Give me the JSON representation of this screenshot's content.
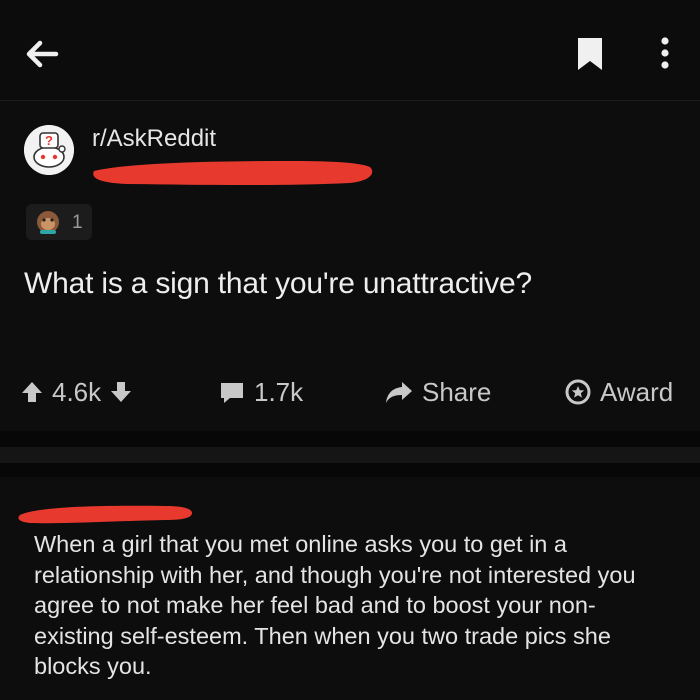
{
  "topbar": {
    "back_icon": "arrow-left-icon",
    "bookmark_icon": "bookmark-icon",
    "more_icon": "more-vertical-icon"
  },
  "post": {
    "subreddit": "r/AskReddit",
    "author_redacted": true,
    "awards": {
      "icon": "award-icon",
      "count": "1"
    },
    "title": "What is a sign that you're unattractive?",
    "actions": {
      "upvotes": "4.6k",
      "comments": "1.7k",
      "share": "Share",
      "award": "Award"
    }
  },
  "comment": {
    "author_redacted": true,
    "body": "When a girl that you met online asks you to get in a relationship with her, and though you're not interested you agree to not make her feel bad and to boost your non-existing self-esteem. Then when you two trade pics she blocks you."
  },
  "colors": {
    "background": "#0d0d0d",
    "text": "#e4e4e4",
    "icon": "#c8c8c8",
    "redaction": "#e8392f"
  }
}
